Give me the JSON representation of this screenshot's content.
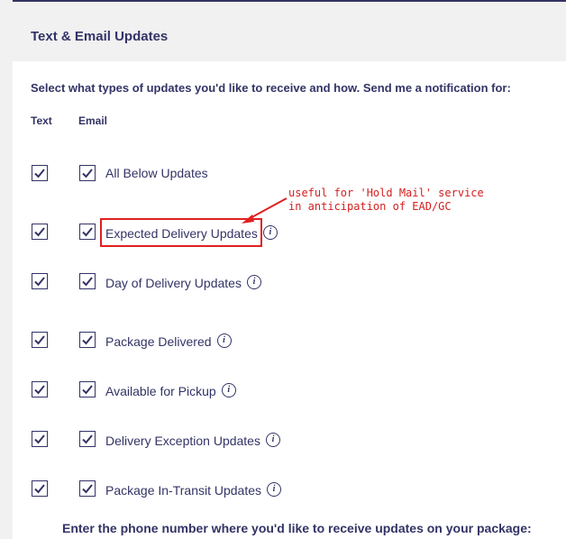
{
  "header": {
    "title": "Text & Email Updates"
  },
  "intro": "Select what types of updates you'd like to receive and how. Send me a notification for:",
  "columns": {
    "text": "Text",
    "email": "Email"
  },
  "rows": [
    {
      "label": "All Below Updates",
      "text_checked": true,
      "email_checked": true,
      "info": false
    },
    {
      "label": "Expected Delivery Updates",
      "text_checked": true,
      "email_checked": true,
      "info": true
    },
    {
      "label": "Day of Delivery Updates",
      "text_checked": true,
      "email_checked": true,
      "info": true
    },
    {
      "label": "Package Delivered",
      "text_checked": true,
      "email_checked": true,
      "info": true
    },
    {
      "label": "Available for Pickup",
      "text_checked": true,
      "email_checked": true,
      "info": true
    },
    {
      "label": "Delivery Exception Updates",
      "text_checked": true,
      "email_checked": true,
      "info": true
    },
    {
      "label": "Package In-Transit Updates",
      "text_checked": true,
      "email_checked": true,
      "info": true
    }
  ],
  "annotation": {
    "line1": "useful for 'Hold Mail' service",
    "line2": "in anticipation of EAD/GC",
    "color": "#d32020"
  },
  "info_glyph": "i",
  "footer": {
    "text": "Enter the phone number where you'd like to receive updates on your package:"
  },
  "colors": {
    "brand": "#333366",
    "panel_bg": "#f1f1f1",
    "annotation": "#e02020"
  }
}
